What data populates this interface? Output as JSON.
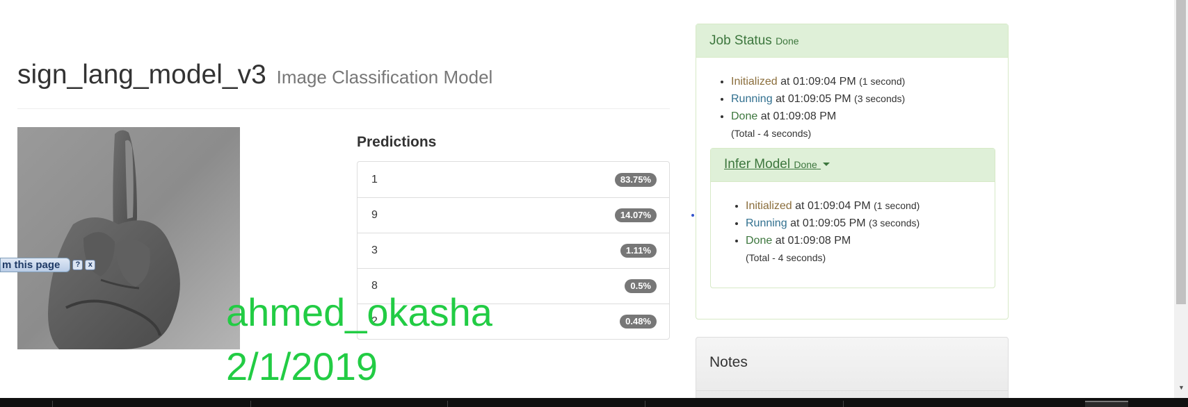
{
  "header": {
    "model_name": "sign_lang_model_v3",
    "model_type": "Image Classification Model"
  },
  "predictions": {
    "heading": "Predictions",
    "items": [
      {
        "label": "1",
        "value": "83.75%"
      },
      {
        "label": "9",
        "value": "14.07%"
      },
      {
        "label": "3",
        "value": "1.11%"
      },
      {
        "label": "8",
        "value": "0.5%"
      },
      {
        "label": "2",
        "value": "0.48%"
      }
    ]
  },
  "job_status": {
    "title": "Job Status",
    "status": "Done",
    "steps": [
      {
        "name": "Initialized",
        "at": "at 01:09:04 PM",
        "duration": "(1 second)"
      },
      {
        "name": "Running",
        "at": "at 01:09:05 PM",
        "duration": "(3 seconds)"
      },
      {
        "name": "Done",
        "at": "at 01:09:08 PM",
        "duration": ""
      }
    ],
    "total": "(Total - 4 seconds)",
    "infer_model": {
      "title": "Infer Model",
      "status": "Done",
      "steps": [
        {
          "name": "Initialized",
          "at": "at 01:09:04 PM",
          "duration": "(1 second)"
        },
        {
          "name": "Running",
          "at": "at 01:09:05 PM",
          "duration": "(3 seconds)"
        },
        {
          "name": "Done",
          "at": "at 01:09:08 PM",
          "duration": ""
        }
      ],
      "total": "(Total - 4 seconds)"
    }
  },
  "notes": {
    "title": "Notes"
  },
  "toolbar_popup": {
    "label": "m this page",
    "help": "?",
    "close": "x"
  },
  "watermark": {
    "name": "ahmed_okasha",
    "date": "2/1/2019"
  },
  "colors": {
    "success_text": "#3c763d",
    "success_bg": "#dff0d8",
    "warning_text": "#8a6d3b",
    "info_text": "#31708f",
    "badge_bg": "#777777",
    "watermark": "#22cc44"
  },
  "icons": {
    "caret": "caret-down-icon",
    "help": "help-icon",
    "close": "close-icon"
  }
}
